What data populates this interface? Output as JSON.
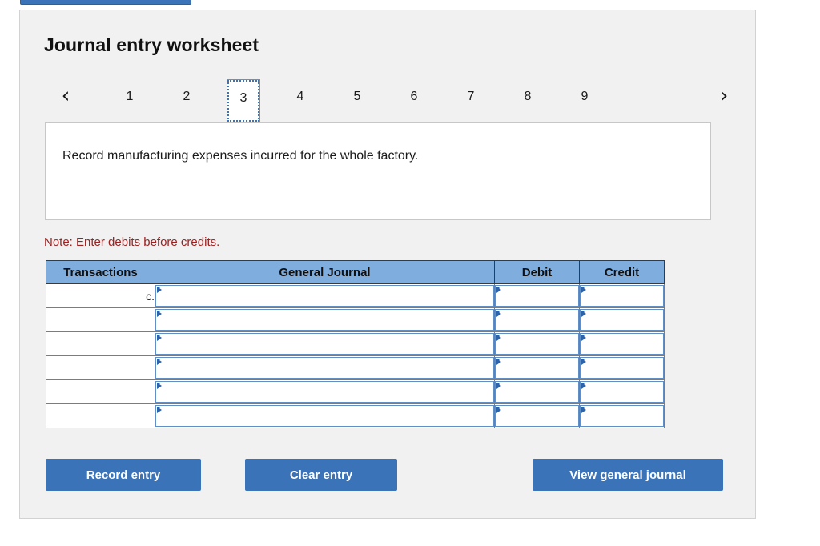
{
  "top_bar": {
    "label": ""
  },
  "panel": {
    "title": "Journal entry worksheet"
  },
  "pager": {
    "prev_icon": "chevron-left-icon",
    "next_icon": "chevron-right-icon",
    "prev_glyph": "‹",
    "next_glyph": "›",
    "tabs": [
      {
        "label": "1",
        "active": false
      },
      {
        "label": "2",
        "active": false
      },
      {
        "label": "3",
        "active": true
      },
      {
        "label": "4",
        "active": false
      },
      {
        "label": "5",
        "active": false
      },
      {
        "label": "6",
        "active": false
      },
      {
        "label": "7",
        "active": false
      },
      {
        "label": "8",
        "active": false
      },
      {
        "label": "9",
        "active": false
      }
    ]
  },
  "prompt": {
    "text": "Record manufacturing expenses incurred for the whole factory."
  },
  "note": {
    "text": "Note: Enter debits before credits."
  },
  "table": {
    "headers": [
      "Transactions",
      "General Journal",
      "Debit",
      "Credit"
    ],
    "rows": [
      {
        "transaction": "c.",
        "general_journal": "",
        "debit": "",
        "credit": ""
      },
      {
        "transaction": "",
        "general_journal": "",
        "debit": "",
        "credit": ""
      },
      {
        "transaction": "",
        "general_journal": "",
        "debit": "",
        "credit": ""
      },
      {
        "transaction": "",
        "general_journal": "",
        "debit": "",
        "credit": ""
      },
      {
        "transaction": "",
        "general_journal": "",
        "debit": "",
        "credit": ""
      },
      {
        "transaction": "",
        "general_journal": "",
        "debit": "",
        "credit": ""
      }
    ]
  },
  "buttons": {
    "record": "Record entry",
    "clear": "Clear entry",
    "view": "View general journal"
  },
  "colors": {
    "button_blue": "#3a73b8",
    "header_blue": "#7fadde",
    "note_red": "#a02020",
    "panel_bg": "#f1f1f1",
    "input_border": "#5f8fc6"
  }
}
